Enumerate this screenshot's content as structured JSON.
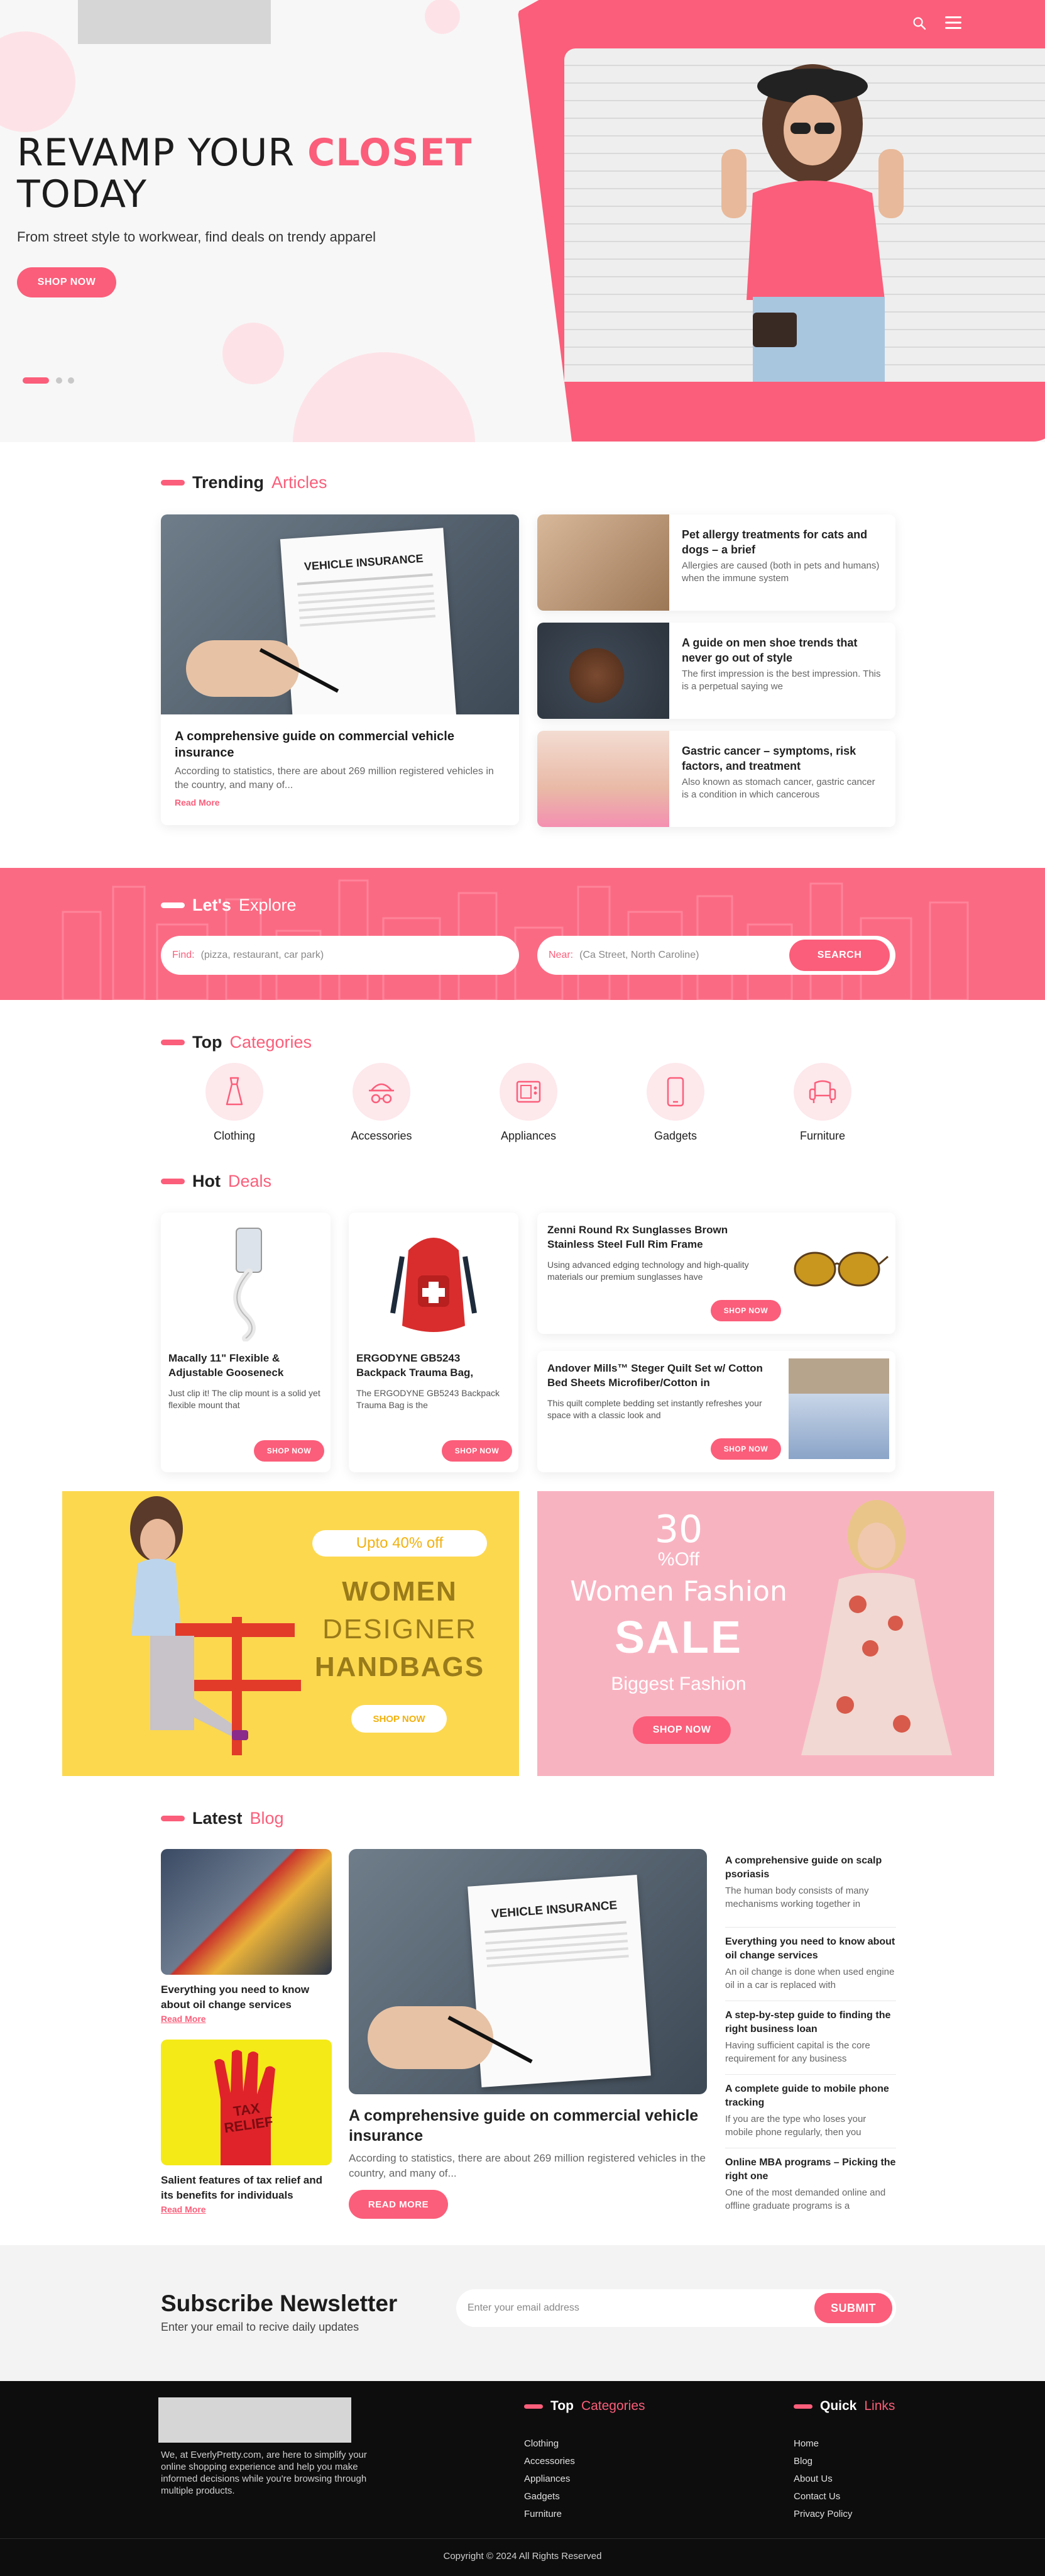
{
  "hero": {
    "title_part1": "REVAMP YOUR ",
    "title_accent": "CLOSET",
    "title_part2": "TODAY",
    "subtitle": "From street style to workwear, find deals on trendy apparel",
    "cta": "SHOP NOW",
    "slides": 3,
    "active_slide": 1
  },
  "header": {
    "search_icon": "search-icon",
    "menu_icon": "hamburger-menu-icon"
  },
  "trending": {
    "title_bold": "Trending",
    "title_light": "Articles",
    "main": {
      "image_text": "VEHICLE INSURANCE",
      "title": "A comprehensive guide on commercial vehicle insurance",
      "excerpt": "According to statistics, there are about 269 million registered vehicles in the country, and many of...",
      "link": "Read More"
    },
    "side": [
      {
        "title": "Pet allergy treatments for cats and dogs – a brief",
        "excerpt": "Allergies are caused (both in pets and humans) when the immune system"
      },
      {
        "title": "A guide on men shoe trends that never go out of style",
        "excerpt": "The first impression is the best impression. This is a perpetual saying we"
      },
      {
        "title": "Gastric cancer – symptoms, risk factors, and treatment",
        "excerpt": "Also known as stomach cancer, gastric cancer is a condition in which cancerous"
      }
    ]
  },
  "explore": {
    "title_bold": "Let's",
    "title_light": "Explore",
    "find_label": "Find:",
    "find_placeholder": "(pizza, restaurant, car park)",
    "near_label": "Near:",
    "near_placeholder": "(Ca Street, North Caroline)",
    "search_button": "SEARCH"
  },
  "categories": {
    "title_bold": "Top",
    "title_light": "Categories",
    "items": [
      {
        "label": "Clothing",
        "icon": "dress-icon"
      },
      {
        "label": "Accessories",
        "icon": "hat-glasses-icon"
      },
      {
        "label": "Appliances",
        "icon": "appliance-icon"
      },
      {
        "label": "Gadgets",
        "icon": "phone-icon"
      },
      {
        "label": "Furniture",
        "icon": "armchair-icon"
      }
    ]
  },
  "deals": {
    "title_bold": "Hot",
    "title_light": "Deals",
    "vertical": [
      {
        "title": "Macally 11\" Flexible & Adjustable Gooseneck",
        "excerpt": "Just clip it! The clip mount is a solid yet flexible mount that",
        "button": "SHOP NOW"
      },
      {
        "title": "ERGODYNE GB5243 Backpack Trauma Bag,",
        "excerpt": "The ERGODYNE GB5243 Backpack Trauma Bag is the",
        "button": "SHOP NOW"
      }
    ],
    "horizontal": [
      {
        "title": "Zenni Round Rx Sunglasses Brown Stainless Steel Full Rim Frame",
        "excerpt": "Using advanced edging technology and high-quality materials our premium sunglasses have",
        "button": "SHOP NOW"
      },
      {
        "title": "Andover Mills™ Steger Quilt Set w/ Cotton Bed Sheets Microfiber/Cotton in",
        "excerpt": "This quilt complete bedding set instantly refreshes your space with a classic look and",
        "button": "SHOP NOW"
      }
    ]
  },
  "banners": {
    "left": {
      "badge": "Upto 40% off",
      "line1": "WOMEN",
      "line2": "DESIGNER",
      "line3": "HANDBAGS",
      "button": "SHOP NOW",
      "bg": "#fcd84f"
    },
    "right": {
      "percent": "30",
      "off": "%Off",
      "line1": "Women Fashion",
      "line2": "SALE",
      "line3": "Biggest Fashion",
      "button": "SHOP NOW",
      "bg": "#f8b3c1"
    }
  },
  "blog": {
    "title_bold": "Latest",
    "title_light": "Blog",
    "small": [
      {
        "title": "Everything you need to know about oil change services",
        "link": "Read More"
      },
      {
        "title": "Salient features of tax relief and its benefits for individuals",
        "link": "Read More"
      }
    ],
    "main": {
      "image_text": "VEHICLE INSURANCE",
      "title": "A comprehensive guide on commercial vehicle insurance",
      "excerpt": "According to statistics, there are about 269 million registered vehicles in the country, and many of...",
      "button": "READ MORE"
    },
    "list": [
      {
        "title": "A comprehensive guide on scalp psoriasis",
        "excerpt": "The human body consists of many mechanisms working together in"
      },
      {
        "title": "Everything you need to know about oil change services",
        "excerpt": "An oil change is done when used engine oil in a car is replaced with"
      },
      {
        "title": "A step-by-step guide to finding the right business loan",
        "excerpt": "Having sufficient capital is the core requirement for any business"
      },
      {
        "title": "A complete guide to mobile phone tracking",
        "excerpt": "If you are the type who loses your mobile phone regularly, then you"
      },
      {
        "title": "Online MBA programs – Picking the right one",
        "excerpt": "One of the most demanded online and offline graduate programs is a"
      }
    ],
    "tax_sign": "TAX RELIEF"
  },
  "newsletter": {
    "title": "Subscribe Newsletter",
    "subtitle": "Enter your email to recive daily updates",
    "placeholder": "Enter your email address",
    "button": "SUBMIT"
  },
  "footer": {
    "about": "We, at EverlyPretty.com, are here to simplify your online shopping experience and help you make informed decisions while you're browsing through multiple products.",
    "categories_bold": "Top",
    "categories_light": "Categories",
    "categories": [
      "Clothing",
      "Accessories",
      "Appliances",
      "Gadgets",
      "Furniture"
    ],
    "links_bold": "Quick",
    "links_light": "Links",
    "links": [
      "Home",
      "Blog",
      "About Us",
      "Contact Us",
      "Privacy Policy"
    ],
    "copyright": "Copyright © 2024 All Rights Reserved"
  },
  "colors": {
    "accent": "#fb5e7a",
    "hero_bg": "#f7f7f7",
    "footer_bg": "#0d0d0d",
    "newsletter_bg": "#f3f3f3"
  }
}
